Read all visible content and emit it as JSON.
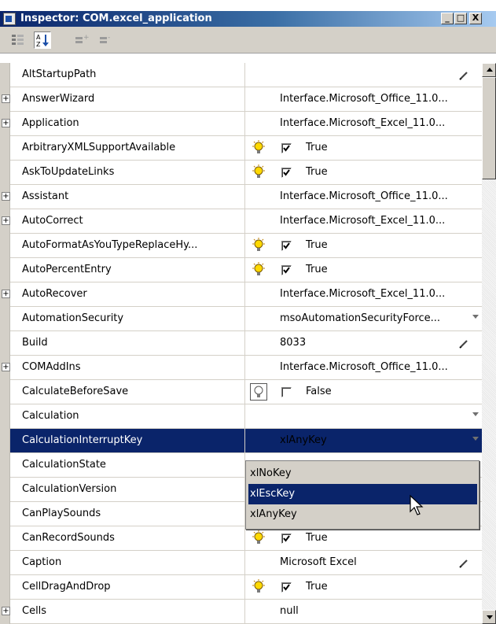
{
  "window": {
    "title": "Inspector: COM.excel_application",
    "minimize_label": "_",
    "maximize_label": "□",
    "close_label": "X"
  },
  "toolbar": {
    "categorized_icon": "categorized-view-icon",
    "alphabetical_icon": "sort-alphabetical-icon",
    "expand_icon": "expand-all-icon",
    "collapse_icon": "collapse-all-icon"
  },
  "colors": {
    "selection": "#0a246a",
    "titlebar_start": "#0a246a",
    "chrome": "#d4d0c8"
  },
  "properties": [
    {
      "name": "AltStartupPath",
      "expandable": false,
      "value": "",
      "control": "pencil"
    },
    {
      "name": "AnswerWizard",
      "expandable": true,
      "value": "Interface.Microsoft_Office_11.0...",
      "control": "text"
    },
    {
      "name": "Application",
      "expandable": true,
      "value": "Interface.Microsoft_Excel_11.0...",
      "control": "text"
    },
    {
      "name": "ArbitraryXMLSupportAvailable",
      "expandable": false,
      "value": "True",
      "control": "bulb-check",
      "checked": true
    },
    {
      "name": "AskToUpdateLinks",
      "expandable": false,
      "value": "True",
      "control": "bulb-check",
      "checked": true
    },
    {
      "name": "Assistant",
      "expandable": true,
      "value": "Interface.Microsoft_Office_11.0...",
      "control": "text"
    },
    {
      "name": "AutoCorrect",
      "expandable": true,
      "value": "Interface.Microsoft_Excel_11.0...",
      "control": "text"
    },
    {
      "name": "AutoFormatAsYouTypeReplaceHy...",
      "expandable": false,
      "value": "True",
      "control": "bulb-check",
      "checked": true
    },
    {
      "name": "AutoPercentEntry",
      "expandable": false,
      "value": "True",
      "control": "bulb-check",
      "checked": true
    },
    {
      "name": "AutoRecover",
      "expandable": true,
      "value": "Interface.Microsoft_Excel_11.0...",
      "control": "text"
    },
    {
      "name": "AutomationSecurity",
      "expandable": false,
      "value": "msoAutomationSecurityForce...",
      "control": "dropdown"
    },
    {
      "name": "Build",
      "expandable": false,
      "value": "8033",
      "control": "pencil"
    },
    {
      "name": "COMAddIns",
      "expandable": true,
      "value": "Interface.Microsoft_Office_11.0...",
      "control": "text"
    },
    {
      "name": "CalculateBeforeSave",
      "expandable": false,
      "value": "False",
      "control": "bulb-check",
      "checked": false
    },
    {
      "name": "Calculation",
      "expandable": false,
      "value": "",
      "control": "dropdown"
    },
    {
      "name": "CalculationInterruptKey",
      "expandable": false,
      "value": "xlAnyKey",
      "control": "dropdown",
      "selected": true
    },
    {
      "name": "CalculationState",
      "expandable": false,
      "value": "",
      "control": "text"
    },
    {
      "name": "CalculationVersion",
      "expandable": false,
      "value": "",
      "control": "text"
    },
    {
      "name": "CanPlaySounds",
      "expandable": false,
      "value": "",
      "control": "text"
    },
    {
      "name": "CanRecordSounds",
      "expandable": false,
      "value": "True",
      "control": "bulb-check",
      "checked": true
    },
    {
      "name": "Caption",
      "expandable": false,
      "value": "Microsoft Excel",
      "control": "pencil"
    },
    {
      "name": "CellDragAndDrop",
      "expandable": false,
      "value": "True",
      "control": "bulb-check",
      "checked": true
    },
    {
      "name": "Cells",
      "expandable": true,
      "value": "null",
      "control": "text"
    }
  ],
  "dropdown_popup": {
    "options": [
      "xlNoKey",
      "xlEscKey",
      "xlAnyKey"
    ],
    "highlighted_index": 1
  }
}
